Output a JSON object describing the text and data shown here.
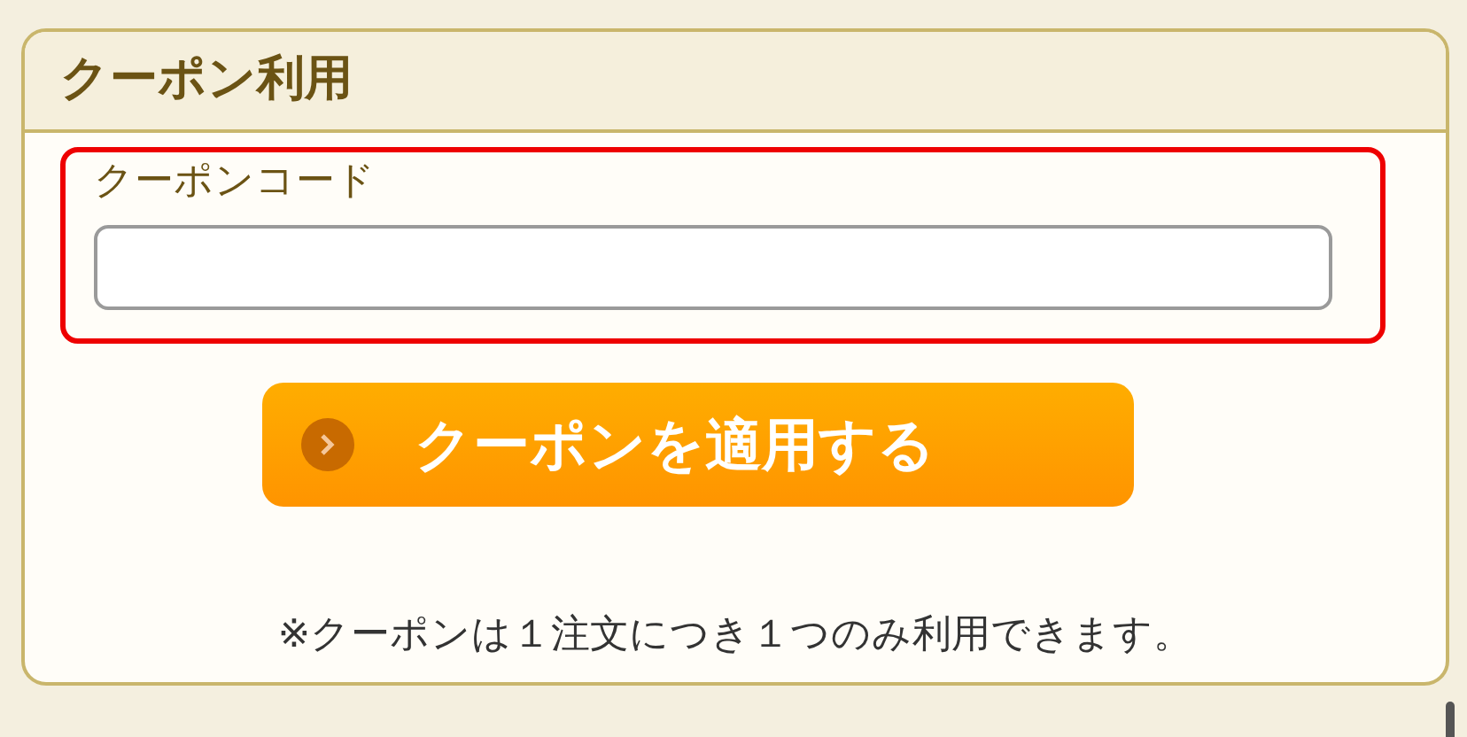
{
  "panel": {
    "title": "クーポン利用"
  },
  "coupon_field": {
    "label": "クーポンコード"
  },
  "apply_button": {
    "label": "クーポンを適用する"
  },
  "note": "※クーポンは１注文につき１つのみ利用できます。"
}
